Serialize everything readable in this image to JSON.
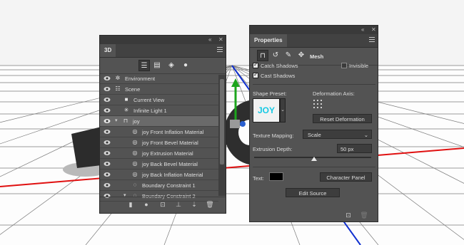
{
  "colors": {
    "panel": "#535353",
    "accent_red": "#e01010",
    "accent_blue": "#1030d0",
    "joy_text": "#16c9e4"
  },
  "panel3d": {
    "title": "3D",
    "toolbar_icons": [
      "whole-scene-icon",
      "meshes-icon",
      "materials-icon",
      "lights-icon"
    ],
    "rows": [
      {
        "label": "Environment",
        "icon": "environment-icon"
      },
      {
        "label": "Scene",
        "icon": "scene-icon"
      },
      {
        "label": "Current View",
        "icon": "camera-icon"
      },
      {
        "label": "Infinite Light 1",
        "icon": "infinite-light-icon"
      },
      {
        "label": "joy",
        "icon": "mesh-icon"
      },
      {
        "label": "joy Front Inflation Material",
        "icon": "material-icon"
      },
      {
        "label": "joy Front Bevel Material",
        "icon": "material-icon"
      },
      {
        "label": "joy Extrusion Material",
        "icon": "material-icon"
      },
      {
        "label": "joy Back Bevel Material",
        "icon": "material-icon"
      },
      {
        "label": "joy Back Inflation Material",
        "icon": "material-icon"
      },
      {
        "label": "Boundary Constraint 1",
        "icon": "constraint-icon"
      },
      {
        "label": "Boundary Constraint 2",
        "icon": "constraint-icon"
      }
    ]
  },
  "properties": {
    "title": "Properties",
    "mode_label": "Mesh",
    "catch_shadows": "Catch Shadows",
    "cast_shadows": "Cast Shadows",
    "invisible": "Invisible",
    "shape_preset_label": "Shape Preset:",
    "shape_preset_preview": "JOY",
    "deformation_axis_label": "Deformation Axis:",
    "reset_deformation": "Reset Deformation",
    "texture_mapping_label": "Texture Mapping:",
    "texture_mapping_value": "Scale",
    "extrusion_depth_label": "Extrusion Depth:",
    "extrusion_depth_value": "50 px",
    "text_label": "Text:",
    "character_panel": "Character Panel",
    "edit_source": "Edit Source"
  }
}
